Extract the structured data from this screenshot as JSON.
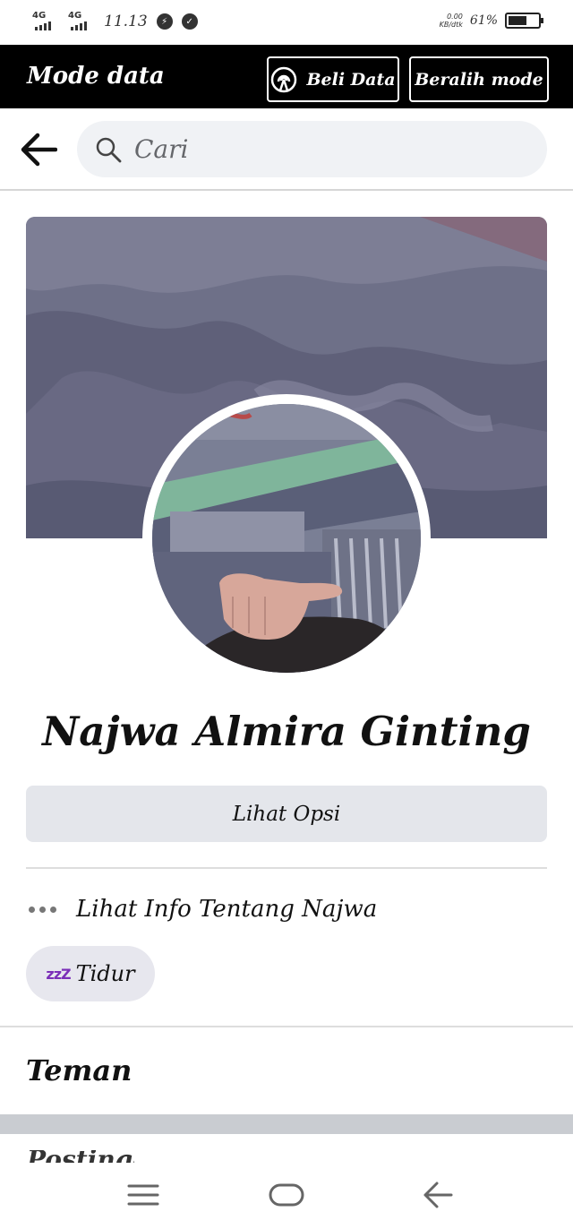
{
  "status_bar": {
    "sim1_label": "4G",
    "sim2_label": "4G",
    "time": "11.13",
    "messenger_icon": "messenger-icon",
    "notif_icon": "check-circle-icon",
    "speed_value": "0.00",
    "speed_unit": "KB/dtk",
    "battery_percent": "61%",
    "battery_level": 0.61
  },
  "mode_bar": {
    "title": "Mode data",
    "buy_data_label": "Beli Data",
    "switch_mode_label": "Beralih mode"
  },
  "search": {
    "placeholder": "Cari"
  },
  "profile": {
    "name": "Najwa Almira Ginting",
    "options_label": "Lihat Opsi",
    "info_label": "Lihat Info Tentang Najwa",
    "status_label": "Tidur",
    "status_icon_text": "zzZ"
  },
  "sections": {
    "friends_title": "Teman",
    "next_section_partial": "Postingan"
  },
  "colors": {
    "mode_bar_bg": "#000000",
    "search_bg": "#f0f2f5",
    "button_bg": "#e4e6eb",
    "status_icon": "#7b2fb8"
  }
}
